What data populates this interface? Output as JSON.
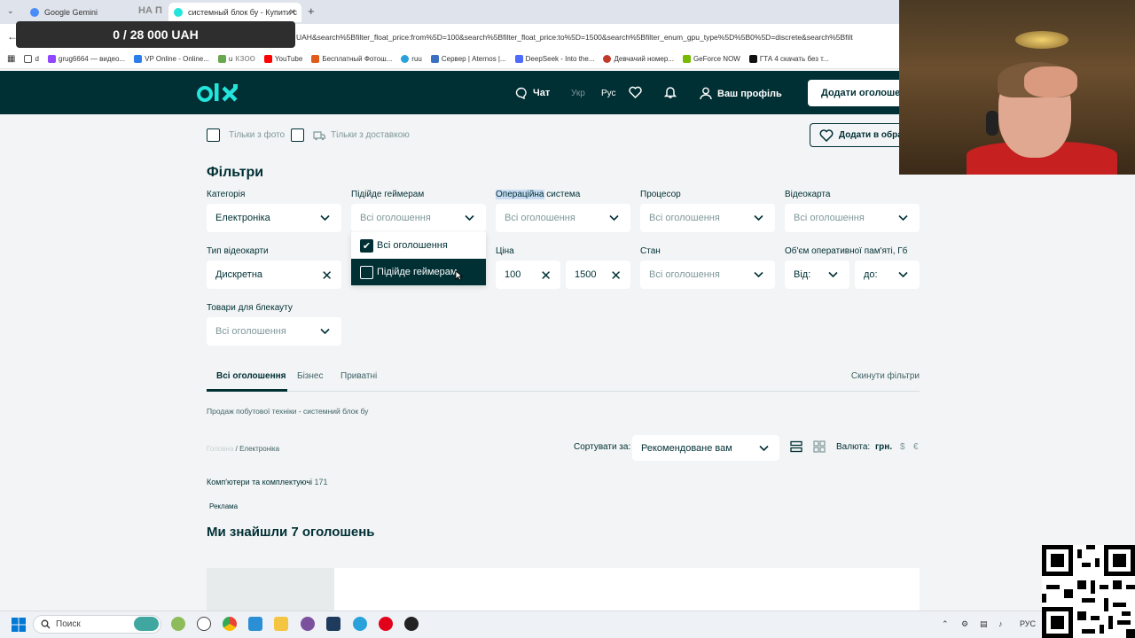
{
  "browser": {
    "tabs": [
      {
        "label": "Google Gemini"
      },
      {
        "label": "системный блок бу - Купити с"
      }
    ],
    "overlay_text": "НА П",
    "url": "UAH&search%5Bfilter_float_price:from%5D=100&search%5Bfilter_float_price:to%5D=1500&search%5Bfilter_enum_gpu_type%5D%5B0%5D=discrete&search%5Bfilt",
    "bookmarks": [
      {
        "label": "d",
        "color": "#555"
      },
      {
        "label": "grug6664 — видео...",
        "color": "#9146ff"
      },
      {
        "label": "VP Online - Online...",
        "color": "#2b7de9"
      },
      {
        "label": "u",
        "color": "#6aa84f"
      },
      {
        "label": "YouTube",
        "color": "#ff0000"
      },
      {
        "label": "Бесплатный Фотош...",
        "color": "#e05a1a"
      },
      {
        "label": "ruu",
        "color": "#2aa1da"
      },
      {
        "label": "Сервер | Aternos |...",
        "color": "#3b6fc2"
      },
      {
        "label": "DeepSeek - Into the...",
        "color": "#4d6bfe"
      },
      {
        "label": "Девчачий номер...",
        "color": "#c0392b"
      },
      {
        "label": "GeForce NOW",
        "color": "#76b900"
      },
      {
        "label": "ГТА 4 скачать без т...",
        "color": "#111"
      }
    ],
    "bookmark_overlay": "КЗОО"
  },
  "donation": {
    "text": "0 / 28 000 UAH"
  },
  "header": {
    "logo": "olx",
    "chat": "Чат",
    "lang_ukr": "Укр",
    "lang_rus": "Рус",
    "profile": "Ваш профіль",
    "add_button": "Додати оголоше"
  },
  "toggles": {
    "photo_only": "Тільки з фото",
    "delivery_only": "Тільки з доставкою",
    "favorites": "Додати в обра"
  },
  "filters": {
    "title": "Фільтри",
    "category": {
      "label": "Категорія",
      "value": "Електроніка"
    },
    "gamers": {
      "label": "Підійде геймерам",
      "value": "Всі оголошення"
    },
    "os": {
      "label_hl": "Операційна",
      "label_rest": " система",
      "value": "Всі оголошення"
    },
    "cpu": {
      "label": "Процесор",
      "value": "Всі оголошення"
    },
    "gpu": {
      "label": "Відеокарта",
      "value": "Всі оголошення"
    },
    "gpu_type": {
      "label": "Тип відеокарти",
      "value": "Дискретна"
    },
    "price": {
      "label": "Ціна",
      "from": "100",
      "to": "1500"
    },
    "condition": {
      "label": "Стан",
      "value": "Всі оголошення"
    },
    "ram": {
      "label": "Об'єм оперативної пам'яті, Гб",
      "from": "Від:",
      "to": "до:"
    },
    "blackout": {
      "label": "Товари для блекауту",
      "value": "Всі оголошення"
    }
  },
  "gamers_dropdown": {
    "items": [
      {
        "label": "Всі оголошення",
        "checked": true
      },
      {
        "label": "Підійде геймерам",
        "checked": false
      }
    ]
  },
  "tabs": {
    "all": "Всі оголошення",
    "business": "Бізнес",
    "private": "Приватні",
    "reset": "Скинути фільтри"
  },
  "search_context": "Продаж побутової техніки - системний блок бу",
  "breadcrumb": {
    "first": "Головна",
    "second": "/ Електроніка"
  },
  "sort": {
    "label": "Сортувати за:",
    "value": "Рекомендоване вам",
    "currency_label": "Валюта:",
    "currency_uah": "грн.",
    "currency_usd": "$",
    "currency_eur": "€"
  },
  "category_count": {
    "label": "Комп'ютери та комплектуючі",
    "count": "171"
  },
  "ad_label": "Реклама",
  "results_title": "Ми знайшли 7 оголошень",
  "taskbar": {
    "search_placeholder": "Поиск",
    "lang": "РУС"
  }
}
